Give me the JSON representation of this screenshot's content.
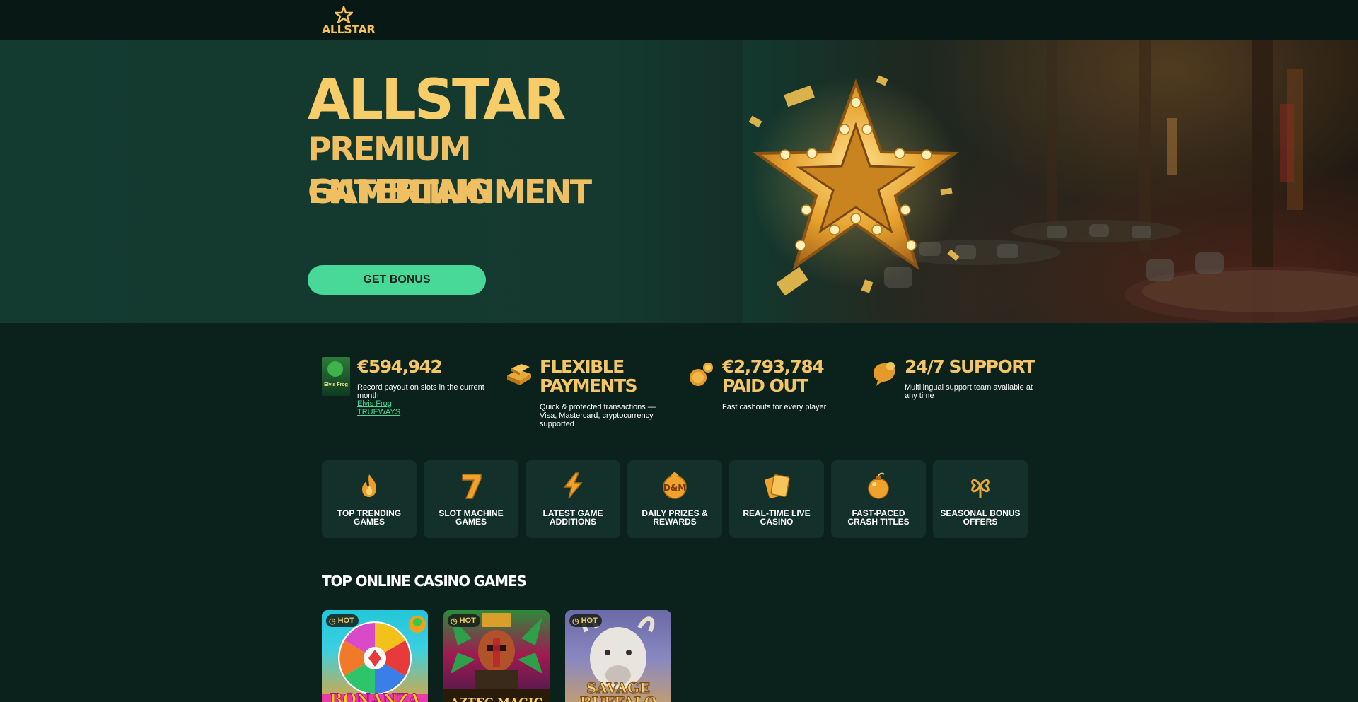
{
  "header": {
    "logo_text": "ALLSTAR"
  },
  "hero": {
    "title": "ALLSTAR",
    "subtitle_line1": "PREMIUM GAMBLING",
    "subtitle_line2": "ENTERTAINMENT",
    "cta_label": "GET BONUS"
  },
  "stats": [
    {
      "title": "€594,942",
      "description": "Record payout on slots in the current month",
      "link": "Elvis Frog TRUEWAYS",
      "thumb_label": "Elvis Frog",
      "icon": "game-thumbnail"
    },
    {
      "title": "FLEXIBLE PAYMENTS",
      "description": "Quick & protected transactions — Visa, Mastercard, cryptocurrency supported",
      "icon": "gold-bars-icon"
    },
    {
      "title": "€2,793,784 PAID OUT",
      "description": "Fast cashouts for every player",
      "icon": "coins-icon"
    },
    {
      "title": "24/7 SUPPORT",
      "description": "Multilingual support team available at any time",
      "icon": "chat-bubble-icon"
    }
  ],
  "categories": [
    {
      "label": "TOP TRENDING GAMES",
      "icon": "flame-icon"
    },
    {
      "label": "SLOT MACHINE GAMES",
      "icon": "seven-icon"
    },
    {
      "label": "LATEST GAME ADDITIONS",
      "icon": "lightning-icon"
    },
    {
      "label": "DAILY PRIZES & REWARDS",
      "icon": "prize-icon",
      "icon_text": "D&M"
    },
    {
      "label": "REAL-TIME LIVE CASINO",
      "icon": "cards-icon"
    },
    {
      "label": "FAST-PACED CRASH TITLES",
      "icon": "bomb-icon"
    },
    {
      "label": "SEASONAL BONUS OFFERS",
      "icon": "clover-icon"
    }
  ],
  "games_section": {
    "title": "TOP ONLINE CASINO GAMES",
    "games": [
      {
        "badge": "HOT",
        "title": "BONANZA"
      },
      {
        "badge": "HOT",
        "title": "AZTEC MAGIC"
      },
      {
        "badge": "HOT",
        "title": "SAVAGE BUFFALO"
      }
    ]
  },
  "colors": {
    "background": "#0b211b",
    "header": "#081814",
    "gold": "#f4c668",
    "accent_green": "#48d897",
    "tile": "#13302a"
  }
}
